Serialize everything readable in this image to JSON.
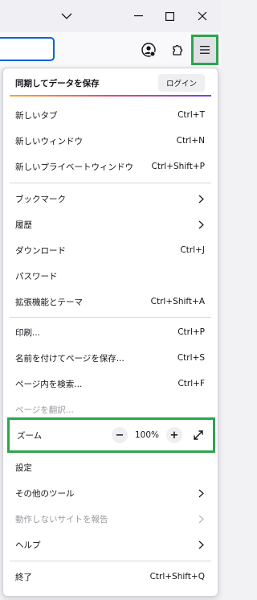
{
  "menu": {
    "sync": {
      "title": "同期してデータを保存",
      "login": "ログイン"
    },
    "new_tab": {
      "label": "新しいタブ",
      "shortcut": "Ctrl+T"
    },
    "new_window": {
      "label": "新しいウィンドウ",
      "shortcut": "Ctrl+N"
    },
    "new_private_window": {
      "label": "新しいプライベートウィンドウ",
      "shortcut": "Ctrl+Shift+P"
    },
    "bookmarks": {
      "label": "ブックマーク"
    },
    "history": {
      "label": "履歴"
    },
    "downloads": {
      "label": "ダウンロード",
      "shortcut": "Ctrl+J"
    },
    "passwords": {
      "label": "パスワード"
    },
    "addons": {
      "label": "拡張機能とテーマ",
      "shortcut": "Ctrl+Shift+A"
    },
    "print": {
      "label": "印刷...",
      "shortcut": "Ctrl+P"
    },
    "save_page": {
      "label": "名前を付けてページを保存...",
      "shortcut": "Ctrl+S"
    },
    "find": {
      "label": "ページ内を検索...",
      "shortcut": "Ctrl+F"
    },
    "translate": {
      "label": "ページを翻訳..."
    },
    "zoom": {
      "label": "ズーム",
      "minus": "−",
      "value": "100%",
      "plus": "+"
    },
    "settings": {
      "label": "設定"
    },
    "more_tools": {
      "label": "その他のツール"
    },
    "report_site": {
      "label": "動作しないサイトを報告"
    },
    "help": {
      "label": "ヘルプ"
    },
    "quit": {
      "label": "終了",
      "shortcut": "Ctrl+Shift+Q"
    }
  },
  "colors": {
    "highlight": "#2ea44f",
    "url_focus": "#0061e0"
  }
}
